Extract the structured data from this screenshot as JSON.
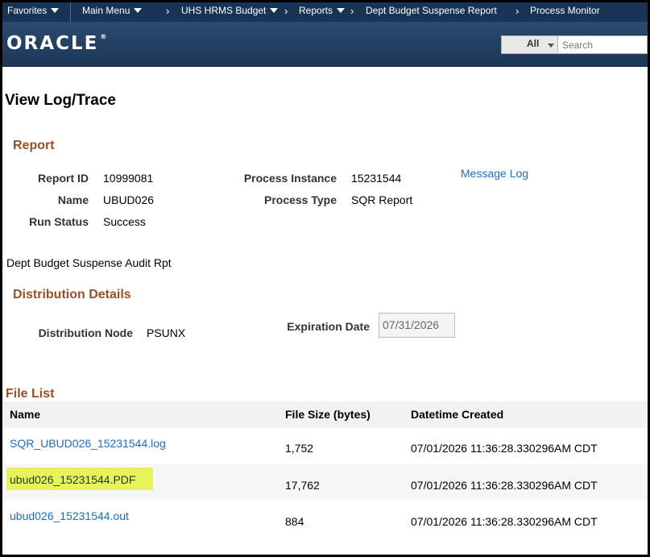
{
  "nav": {
    "favorites": "Favorites",
    "main_menu": "Main Menu",
    "crumbs": [
      "UHS HRMS Budget",
      "Reports",
      "Dept Budget Suspense Report",
      "Process Monitor"
    ]
  },
  "brand": {
    "logo": "ORACLE",
    "logo_mark": "®"
  },
  "search": {
    "scope": "All",
    "placeholder": "Search"
  },
  "page": {
    "title": "View Log/Trace"
  },
  "report": {
    "section": "Report",
    "report_id_label": "Report ID",
    "report_id": "10999081",
    "name_label": "Name",
    "name": "UBUD026",
    "run_status_label": "Run Status",
    "run_status": "Success",
    "process_instance_label": "Process Instance",
    "process_instance": "15231544",
    "process_type_label": "Process Type",
    "process_type": "SQR Report",
    "message_log": "Message Log",
    "description": "Dept Budget Suspense Audit Rpt"
  },
  "distribution": {
    "section": "Distribution Details",
    "node_label": "Distribution Node",
    "node": "PSUNX",
    "expiration_label": "Expiration Date",
    "expiration": "07/31/2026"
  },
  "file_list": {
    "section": "File List",
    "columns": [
      "Name",
      "File Size (bytes)",
      "Datetime Created"
    ],
    "rows": [
      {
        "name": "SQR_UBUD026_15231544.log",
        "size": "1,752",
        "created": "07/01/2026 11:36:28.330296AM CDT"
      },
      {
        "name": "ubud026_15231544.PDF",
        "size": "17,762",
        "created": "07/01/2026 11:36:28.330296AM CDT"
      },
      {
        "name": "ubud026_15231544.out",
        "size": "884",
        "created": "07/01/2026 11:36:28.330296AM CDT"
      }
    ]
  },
  "colors": {
    "nav_bg": "#183455",
    "section_heading": "#9a4f25",
    "link": "#1d6fb8",
    "highlight": "#e9f25b"
  }
}
